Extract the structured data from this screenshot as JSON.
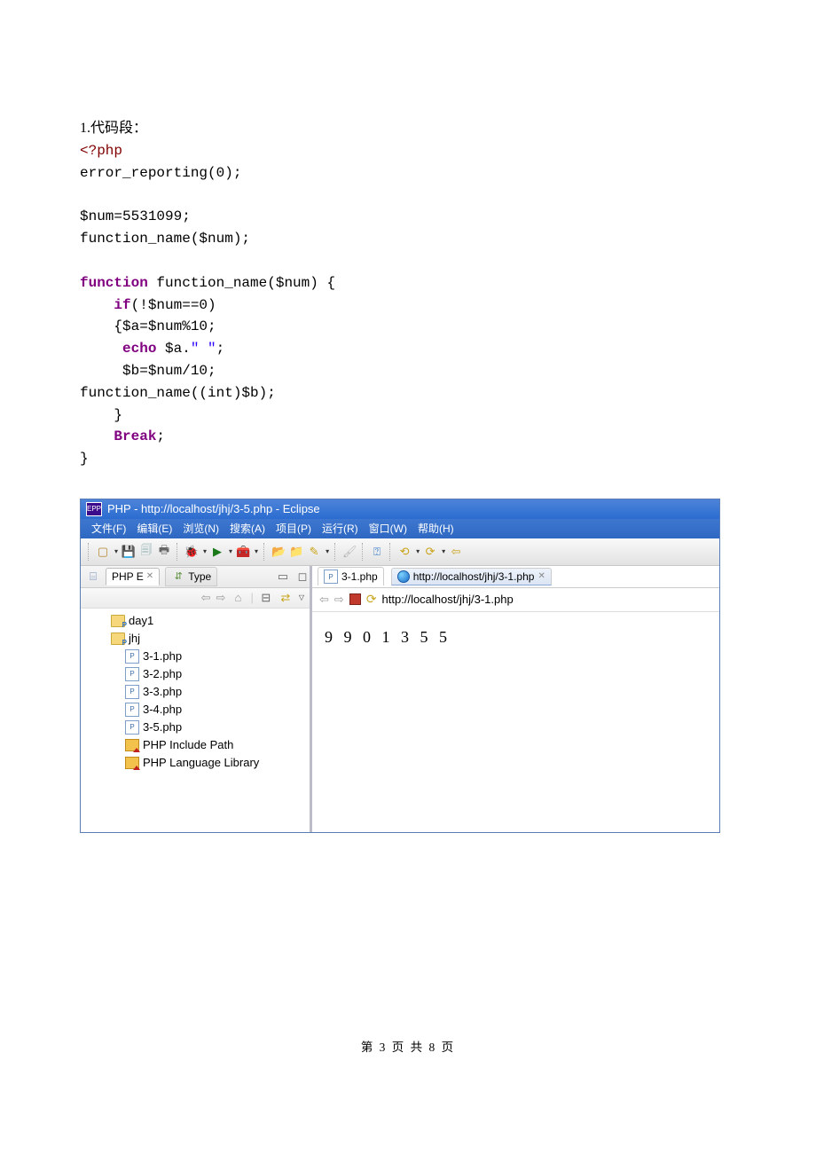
{
  "intro": "1.代码段：",
  "code": {
    "l1": "<?php",
    "l2": "error_reporting(0);",
    "l3": "$num=5531099;",
    "l4": "function_name($num);",
    "l5a": "function",
    "l5b": " function_name($num) {",
    "l6a": "    if",
    "l6b": "(!$num==0)",
    "l7": "    {$a=$num%10;",
    "l8a": "     echo",
    "l8b": " $a.",
    "l8c": "\" \"",
    "l8d": ";",
    "l9": "     $b=$num/10;",
    "l10": "function_name((int)$b);",
    "l11": "    }",
    "l12a": "    Break",
    "l12b": ";",
    "l13": "}"
  },
  "eclipse": {
    "title": "PHP - http://localhost/jhj/3-5.php - Eclipse",
    "titleIconText": "EPP",
    "menu": [
      "文件(F)",
      "编辑(E)",
      "浏览(N)",
      "搜索(A)",
      "项目(P)",
      "运行(R)",
      "窗口(W)",
      "帮助(H)"
    ],
    "leftTabs": {
      "active": "PHP E",
      "activeClose": "✕",
      "inactive": "Type"
    },
    "tree": {
      "folders": [
        "day1",
        "jhj"
      ],
      "files": [
        "3-1.php",
        "3-2.php",
        "3-3.php",
        "3-4.php",
        "3-5.php"
      ],
      "libs": [
        "PHP Include Path",
        "PHP Language Library"
      ]
    },
    "rightTabs": {
      "first": "3-1.php",
      "second": "http://localhost/jhj/3-1.php",
      "secondClose": "✕"
    },
    "addressBar": "http://localhost/jhj/3-1.php",
    "output": "9 9 0 1 3 5 5"
  },
  "footer": "第 3 页 共 8 页"
}
